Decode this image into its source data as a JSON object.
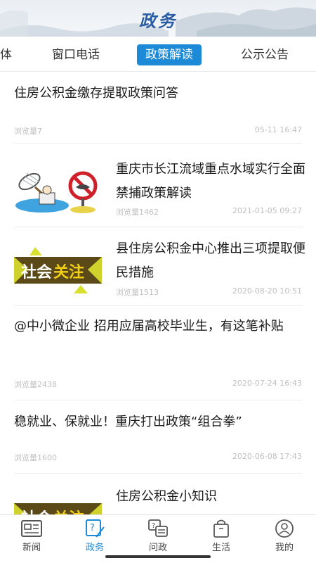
{
  "header": {
    "title": "政务"
  },
  "tabs": [
    {
      "label": "体"
    },
    {
      "label": "窗口电话"
    },
    {
      "label": "政策解读",
      "active": true
    },
    {
      "label": "公示公告"
    }
  ],
  "articles": [
    {
      "title": "住房公积金缴存提取政策问答",
      "views": "浏览量7",
      "date": "05-11 16:47"
    },
    {
      "title": "重庆市长江流域重点水域实行全面禁捕政策解读",
      "views": "浏览量1462",
      "date": "2021-01-05 09:27",
      "thumb": "fishing-ban-illustration"
    },
    {
      "title": "县住房公积金中心推出三项提取便民措施",
      "views": "浏览量1513",
      "date": "2020-08-20 10:51",
      "thumb": "社会关注"
    },
    {
      "title": "@中小微企业 招用应届高校毕业生，有这笔补贴",
      "views": "浏览量2438",
      "date": "2020-07-24 16:43"
    },
    {
      "title": "稳就业、保就业！重庆打出政策“组合拳”",
      "views": "浏览量1600",
      "date": "2020-06-08 17:43"
    },
    {
      "title": "住房公积金小知识",
      "thumb": "社会关注"
    }
  ],
  "thumb_text": {
    "social": "社会",
    "focus": "关注"
  },
  "tabbar": [
    {
      "label": "新闻",
      "icon": "news-icon"
    },
    {
      "label": "政务",
      "icon": "government-icon",
      "active": true
    },
    {
      "label": "问政",
      "icon": "chat-icon"
    },
    {
      "label": "生活",
      "icon": "shopping-bag-icon"
    },
    {
      "label": "我的",
      "icon": "user-icon"
    }
  ],
  "colors": {
    "accent": "#1c8ad6",
    "header_title": "#2a5ca3",
    "meta": "#c0c0c0"
  }
}
